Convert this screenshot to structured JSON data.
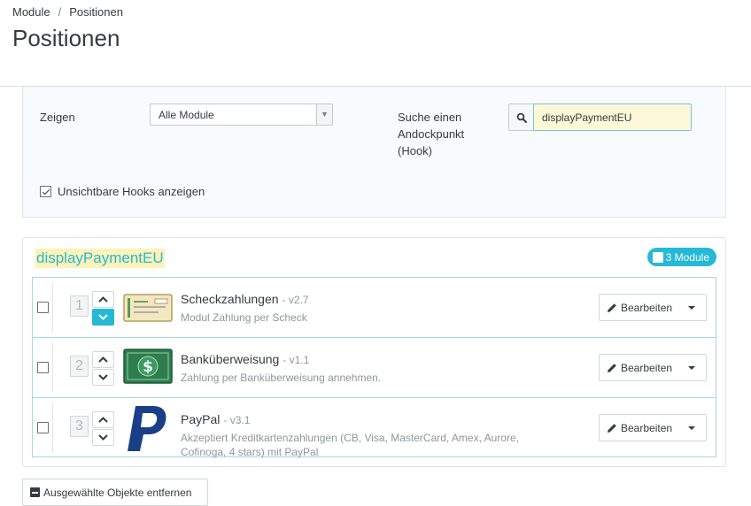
{
  "breadcrumb": {
    "parent": "Module",
    "separator": "/",
    "current": "Positionen"
  },
  "page": {
    "title": "Positionen"
  },
  "filter": {
    "show_label": "Zeigen",
    "show_selected": "Alle Module",
    "hook_label": "Suche einen Andockpunkt (Hook)",
    "hook_search_value": "displayPaymentEU",
    "invisible_hooks_label": "Unsichtbare Hooks anzeigen",
    "invisible_hooks_checked": true
  },
  "hook": {
    "name": "displayPaymentEU",
    "module_count": "3 Module",
    "modules": [
      {
        "position": "1",
        "name": "Scheckzahlungen",
        "version": "- v2.7",
        "description": "Modul Zahlung per Scheck",
        "logo": "check-logo-icon",
        "edit_label": "Bearbeiten"
      },
      {
        "position": "2",
        "name": "Banküberweisung",
        "version": "- v1.1",
        "description": "Zahlung per Banküberweisung annehmen.",
        "logo": "banknote-logo-icon",
        "edit_label": "Bearbeiten"
      },
      {
        "position": "3",
        "name": "PayPal",
        "version": "- v3.1",
        "description": "Akzeptiert Kreditkartenzahlungen (CB, Visa, MasterCard, Amex, Aurore, Cofinoga, 4 stars) mit PayPal",
        "logo": "paypal-logo-icon",
        "edit_label": "Bearbeiten"
      }
    ]
  },
  "actions": {
    "remove_selected_label": "Ausgewählte Objekte entfernen"
  },
  "colors": {
    "accent": "#25b9d7",
    "highlight": "#fdf2b7",
    "text": "#363a41",
    "muted": "#8a979e",
    "panel_bg": "#f8fbfd"
  }
}
